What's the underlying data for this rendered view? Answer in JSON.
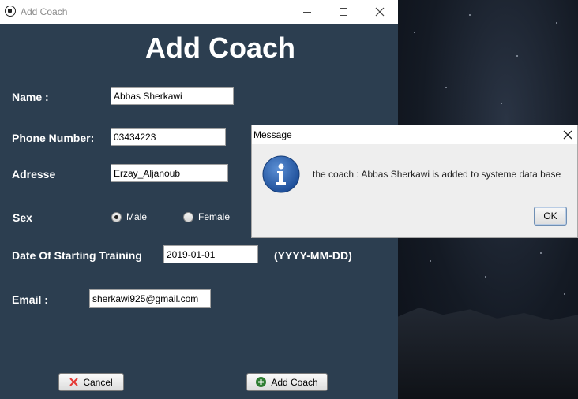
{
  "window": {
    "title": "Add Coach",
    "app_icon": "soccer-ball-icon",
    "minimize_icon": "minimize-icon",
    "maximize_icon": "maximize-icon",
    "close_icon": "close-icon"
  },
  "form": {
    "heading": "Add Coach",
    "name_label": "Name :",
    "name_value": "Abbas Sherkawi",
    "phone_label": "Phone Number:",
    "phone_value": "03434223",
    "address_label": "Adresse",
    "address_value": "Erzay_Aljanoub",
    "sex_label": "Sex",
    "sex_options": [
      "Male",
      "Female"
    ],
    "sex_selected": "Male",
    "date_label": "Date Of Starting Training",
    "date_value": "2019-01-01",
    "date_format_hint": "(YYYY-MM-DD)",
    "email_label": "Email :",
    "email_value": "sherkawi925@gmail.com",
    "cancel_label": "Cancel",
    "add_label": "Add Coach"
  },
  "dialog": {
    "title": "Message",
    "message": "the coach : Abbas Sherkawi is added to systeme data base",
    "ok_label": "OK",
    "icon": "info-icon"
  },
  "colors": {
    "form_background": "#2c3e50",
    "cancel_icon": "#e53935",
    "add_icon": "#2e7d32",
    "info_icon": "#1e5aa8"
  }
}
